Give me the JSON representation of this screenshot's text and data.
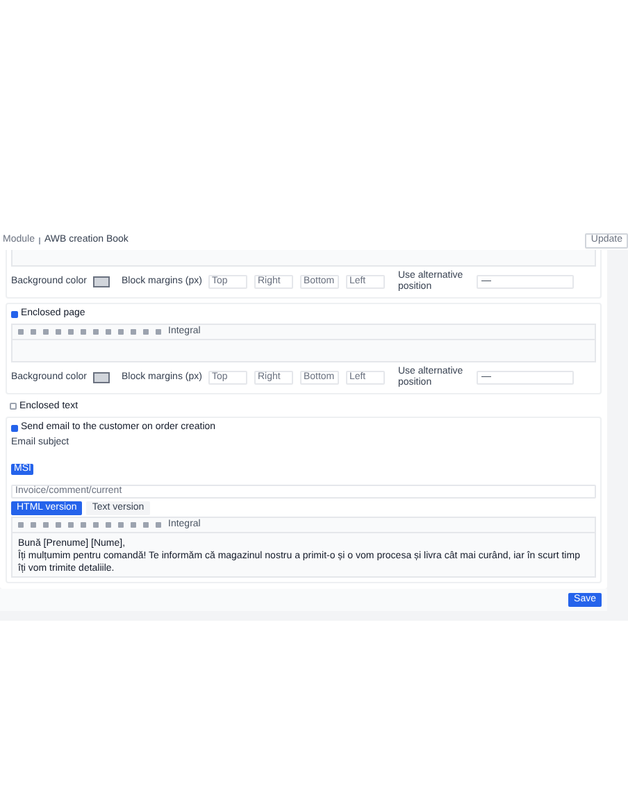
{
  "breadcrumb": [
    {
      "label": "Module"
    },
    {
      "label": "AWB creation Book"
    }
  ],
  "header_button": "Update",
  "blocks": [
    {
      "kind": "editor",
      "cut_top": true,
      "settings": {
        "bg_label": "Background color",
        "margin_label": "Block margins (px)",
        "margins": [
          "Top",
          "Right",
          "Bottom",
          "Left"
        ],
        "position_label": "Use alternative position",
        "position_value": "—"
      }
    },
    {
      "kind": "editor",
      "title": "Enclosed page",
      "checked": true,
      "font": "Integral",
      "settings": {
        "bg_label": "Background color",
        "margin_label": "Block margins (px)",
        "margins": [
          "Top",
          "Right",
          "Bottom",
          "Left"
        ],
        "position_label": "Use alternative position",
        "position_value": "—"
      }
    },
    {
      "kind": "checkbox",
      "title": "Enclosed text",
      "checked": false
    },
    {
      "kind": "email",
      "title": "Send email to the customer on order creation",
      "checked": true,
      "subject_label": "Email subject",
      "tag": "MSI",
      "subject_value": "Invoice/comment/current",
      "tabs": [
        {
          "label": "HTML version",
          "selected": true
        },
        {
          "label": "Text version",
          "selected": false
        }
      ],
      "font": "Integral",
      "body": [
        "Bună [Prenume] [Nume],",
        "Îți mulțumim pentru comandă! Te informăm că magazinul nostru a primit-o și o vom procesa și livra cât mai curând, iar în scurt timp îți vom trimite detaliile."
      ]
    }
  ],
  "save_button": "Save"
}
